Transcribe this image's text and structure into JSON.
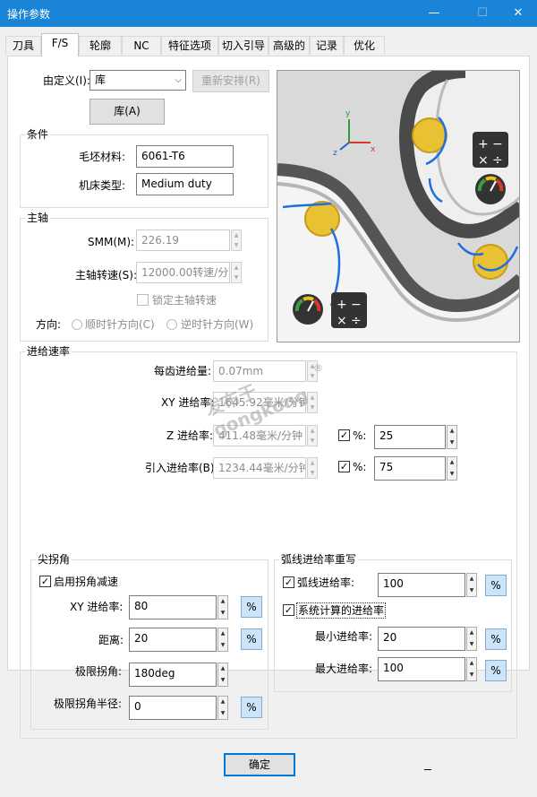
{
  "window": {
    "title": "操作参数",
    "minimize_icon": "—",
    "maximize_icon": "☐",
    "close_icon": "✕"
  },
  "tabs": [
    {
      "label": "刀具",
      "active": false
    },
    {
      "label": "F/S",
      "active": true
    },
    {
      "label": "轮廓",
      "active": false
    },
    {
      "label": "NC",
      "active": false
    },
    {
      "label": "特征选项",
      "active": false
    },
    {
      "label": "切入引导",
      "active": false
    },
    {
      "label": "高级的",
      "active": false
    },
    {
      "label": "记录",
      "active": false
    },
    {
      "label": "优化",
      "active": false
    }
  ],
  "define": {
    "label": "由定义(I):",
    "value": "库",
    "reschedule_button": "重新安排(R)",
    "library_button": "库(A)"
  },
  "conditions": {
    "title": "条件",
    "stock_material_label": "毛坯材料:",
    "stock_material_value": "6061-T6",
    "machine_type_label": "机床类型:",
    "machine_type_value": "Medium duty"
  },
  "spindle": {
    "title": "主轴",
    "smm_label": "SMM(M):",
    "smm_value": "226.19",
    "speed_label": "主轴转速(S):",
    "speed_value": "12000.00转速/分钟",
    "lock_label": "锁定主轴转速",
    "lock_checked": false,
    "direction_label": "方向:",
    "cw_label": "顺时针方向(C)",
    "ccw_label": "逆时针方向(W)"
  },
  "feed": {
    "title": "进给速率",
    "per_tooth_label": "每齿进给量:",
    "per_tooth_value": "0.07mm",
    "xy_label": "XY 进给率:",
    "xy_value": "1645.92毫米/分钟",
    "z_label": "Z 进给率:",
    "z_value": "411.48毫米/分钟",
    "z_pct_label": "%:",
    "z_pct_value": "25",
    "z_pct_checked": true,
    "lead_label": "引入进给率(B):",
    "lead_value": "1234.44毫米/分钟",
    "lead_pct_label": "%:",
    "lead_pct_value": "75",
    "lead_pct_checked": true
  },
  "corner": {
    "title": "尖拐角",
    "enable_label": "启用拐角减速",
    "enable_checked": true,
    "xy_label": "XY 进给率:",
    "xy_value": "80",
    "distance_label": "距离:",
    "distance_value": "20",
    "limit_angle_label": "极限拐角:",
    "limit_angle_value": "180deg",
    "limit_radius_label": "极限拐角半径:",
    "limit_radius_value": "0",
    "pct_label": "%"
  },
  "arc": {
    "title": "弧线进给率重写",
    "arc_feed_label": "弧线进给率:",
    "arc_feed_value": "100",
    "arc_feed_checked": true,
    "system_label": "系统计算的进给率",
    "system_checked": true,
    "min_label": "最小进给率:",
    "min_value": "20",
    "max_label": "最大进给率:",
    "max_value": "100",
    "pct_label": "%"
  },
  "ok_button": "确定",
  "watermark": {
    "line1": "发布于",
    "line2": "gongkong",
    "reg": "®"
  },
  "preview": {
    "gauge_colors": [
      "#3aa040",
      "#e6c619",
      "#d6392b"
    ],
    "coin_color": "#e9c233",
    "arrow_color": "#1f6fe0"
  }
}
